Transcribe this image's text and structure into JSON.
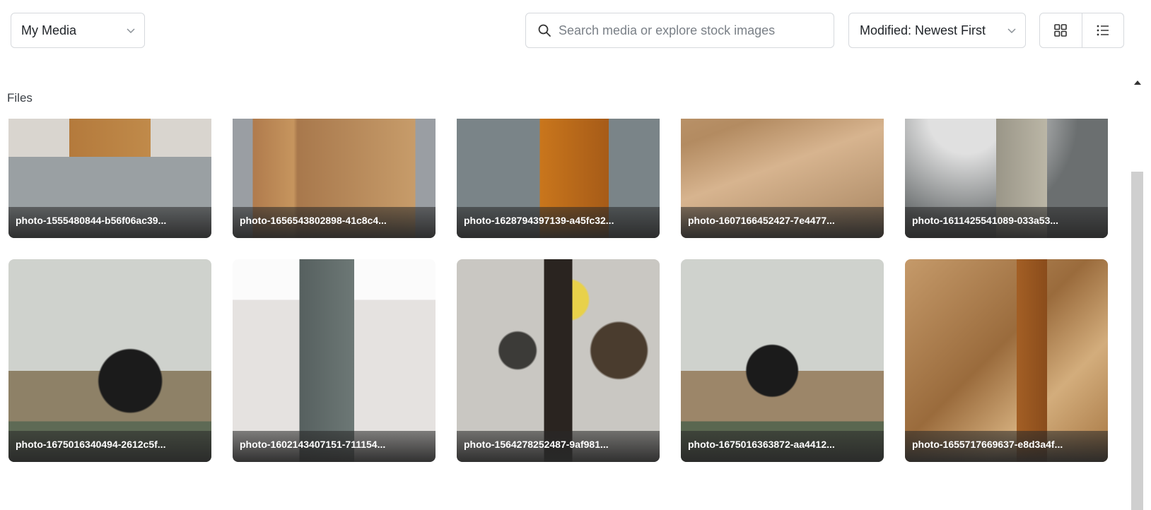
{
  "toolbar": {
    "media_select": {
      "value": "My Media",
      "icon": "chevron-down-icon"
    },
    "search": {
      "placeholder": "Search media or explore stock images",
      "icon": "search-icon"
    },
    "sort_select": {
      "value": "Modified: Newest First",
      "icon": "chevron-down-icon"
    },
    "view_toggle": {
      "grid_icon": "grid-view-icon",
      "list_icon": "list-view-icon"
    }
  },
  "section": {
    "label": "Files"
  },
  "files": [
    {
      "name": "photo-1555480844-b56f06ac39..."
    },
    {
      "name": "photo-1656543802898-41c8c4..."
    },
    {
      "name": "photo-1628794397139-a45fc32..."
    },
    {
      "name": "photo-1607166452427-7e4477..."
    },
    {
      "name": "photo-1611425541089-033a53..."
    },
    {
      "name": "photo-1675016340494-2612c5f..."
    },
    {
      "name": "photo-1602143407151-711154..."
    },
    {
      "name": "photo-1564278252487-9af981..."
    },
    {
      "name": "photo-1675016363872-aa4412..."
    },
    {
      "name": "photo-1655717669637-e8d3a4f..."
    }
  ],
  "colors": {
    "border": "#d6d9dd",
    "caption_bg": "#2a2a2a",
    "scrollbar": "#cfcfcf"
  }
}
